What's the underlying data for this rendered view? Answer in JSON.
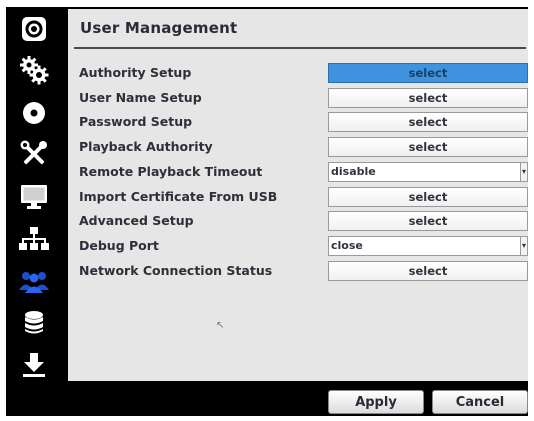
{
  "sidebar": {
    "items": [
      {
        "icon": "camera-lens-icon"
      },
      {
        "icon": "gears-icon"
      },
      {
        "icon": "disc-icon"
      },
      {
        "icon": "tools-icon"
      },
      {
        "icon": "monitor-icon"
      },
      {
        "icon": "network-icon"
      },
      {
        "icon": "users-icon",
        "active": true
      },
      {
        "icon": "database-icon"
      },
      {
        "icon": "download-icon"
      }
    ]
  },
  "panel": {
    "title": "User Management",
    "rows": [
      {
        "label": "Authority Setup",
        "control": "button",
        "value": "select",
        "focused": true
      },
      {
        "label": "User Name Setup",
        "control": "button",
        "value": "select"
      },
      {
        "label": "Password Setup",
        "control": "button",
        "value": "select"
      },
      {
        "label": "Playback Authority",
        "control": "button",
        "value": "select"
      },
      {
        "label": "Remote Playback Timeout",
        "control": "dropdown",
        "value": "disable"
      },
      {
        "label": "Import Certificate From USB",
        "control": "button",
        "value": "select"
      },
      {
        "label": "Advanced Setup",
        "control": "button",
        "value": "select"
      },
      {
        "label": "Debug Port",
        "control": "dropdown",
        "value": "close"
      },
      {
        "label": "Network Connection Status",
        "control": "button",
        "value": "select"
      }
    ]
  },
  "footer": {
    "apply_label": "Apply",
    "cancel_label": "Cancel"
  },
  "colors": {
    "focused_button": "#3f92dd",
    "active_icon": "#1f4fd1",
    "panel_background": "#e6e6e6"
  }
}
